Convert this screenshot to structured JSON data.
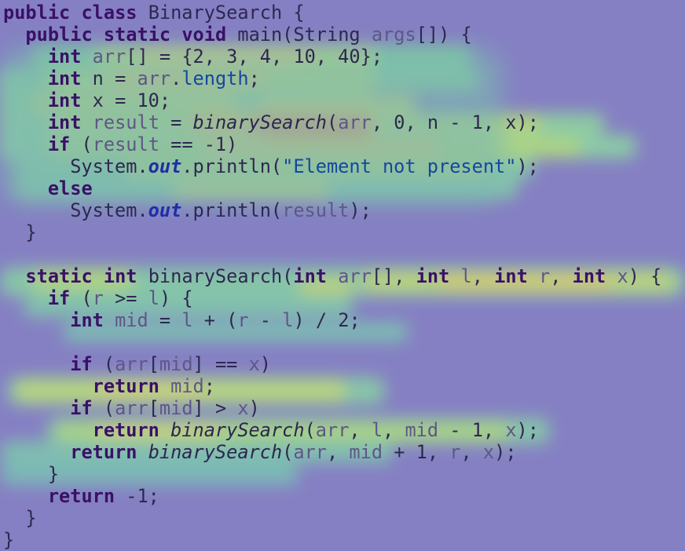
{
  "code": {
    "lines": [
      [
        [
          "kw",
          "public"
        ],
        [
          "id",
          " "
        ],
        [
          "kw",
          "class"
        ],
        [
          "id",
          " BinarySearch {"
        ]
      ],
      [
        [
          "id",
          "  "
        ],
        [
          "kw",
          "public"
        ],
        [
          "id",
          " "
        ],
        [
          "kw",
          "static"
        ],
        [
          "id",
          " "
        ],
        [
          "kw",
          "void"
        ],
        [
          "id",
          " main(String "
        ],
        [
          "var",
          "args"
        ],
        [
          "pun",
          "[]) {"
        ]
      ],
      [
        [
          "id",
          "    "
        ],
        [
          "kw",
          "int"
        ],
        [
          "id",
          " "
        ],
        [
          "var",
          "arr"
        ],
        [
          "pun",
          "[] = {2, 3, 4, 10, 40};"
        ]
      ],
      [
        [
          "id",
          "    "
        ],
        [
          "kw",
          "int"
        ],
        [
          "id",
          " n = "
        ],
        [
          "var",
          "arr"
        ],
        [
          "pun",
          "."
        ],
        [
          "str",
          "length"
        ],
        [
          "pun",
          ";"
        ]
      ],
      [
        [
          "id",
          "    "
        ],
        [
          "kw",
          "int"
        ],
        [
          "id",
          " x = 10;"
        ]
      ],
      [
        [
          "id",
          "    "
        ],
        [
          "kw",
          "int"
        ],
        [
          "id",
          " "
        ],
        [
          "var",
          "result"
        ],
        [
          "id",
          " = "
        ],
        [
          "mth",
          "binarySearch"
        ],
        [
          "pun",
          "("
        ],
        [
          "var",
          "arr"
        ],
        [
          "pun",
          ", 0, n - 1, x);"
        ]
      ],
      [
        [
          "id",
          "    "
        ],
        [
          "kw",
          "if"
        ],
        [
          "id",
          " ("
        ],
        [
          "var",
          "result"
        ],
        [
          "id",
          " == -1)"
        ]
      ],
      [
        [
          "id",
          "      System."
        ],
        [
          "fld",
          "out"
        ],
        [
          "id",
          ".println("
        ],
        [
          "str",
          "\"Element not present\""
        ],
        [
          "id",
          ");"
        ]
      ],
      [
        [
          "id",
          "    "
        ],
        [
          "kw",
          "else"
        ]
      ],
      [
        [
          "id",
          "      System."
        ],
        [
          "fld",
          "out"
        ],
        [
          "id",
          ".println("
        ],
        [
          "var",
          "result"
        ],
        [
          "id",
          ");"
        ]
      ],
      [
        [
          "id",
          "  }"
        ]
      ],
      [
        [
          "id",
          ""
        ]
      ],
      [
        [
          "id",
          "  "
        ],
        [
          "kw",
          "static"
        ],
        [
          "id",
          " "
        ],
        [
          "kw",
          "int"
        ],
        [
          "id",
          " binarySearch("
        ],
        [
          "kw",
          "int"
        ],
        [
          "id",
          " "
        ],
        [
          "var",
          "arr"
        ],
        [
          "pun",
          "[], "
        ],
        [
          "kw",
          "int"
        ],
        [
          "id",
          " "
        ],
        [
          "var",
          "l"
        ],
        [
          "pun",
          ", "
        ],
        [
          "kw",
          "int"
        ],
        [
          "id",
          " "
        ],
        [
          "var",
          "r"
        ],
        [
          "pun",
          ", "
        ],
        [
          "kw",
          "int"
        ],
        [
          "id",
          " "
        ],
        [
          "var",
          "x"
        ],
        [
          "pun",
          ") {"
        ]
      ],
      [
        [
          "id",
          "    "
        ],
        [
          "kw",
          "if"
        ],
        [
          "id",
          " ("
        ],
        [
          "var",
          "r"
        ],
        [
          "id",
          " >= "
        ],
        [
          "var",
          "l"
        ],
        [
          "pun",
          ") {"
        ]
      ],
      [
        [
          "id",
          "      "
        ],
        [
          "kw",
          "int"
        ],
        [
          "id",
          " "
        ],
        [
          "var",
          "mid"
        ],
        [
          "id",
          " = "
        ],
        [
          "var",
          "l"
        ],
        [
          "id",
          " + ("
        ],
        [
          "var",
          "r"
        ],
        [
          "id",
          " - "
        ],
        [
          "var",
          "l"
        ],
        [
          "pun",
          ") / 2;"
        ]
      ],
      [
        [
          "id",
          ""
        ]
      ],
      [
        [
          "id",
          "      "
        ],
        [
          "kw",
          "if"
        ],
        [
          "id",
          " ("
        ],
        [
          "var",
          "arr"
        ],
        [
          "pun",
          "["
        ],
        [
          "var",
          "mid"
        ],
        [
          "pun",
          "] == "
        ],
        [
          "var",
          "x"
        ],
        [
          "pun",
          ")"
        ]
      ],
      [
        [
          "id",
          "        "
        ],
        [
          "kw",
          "return"
        ],
        [
          "id",
          " "
        ],
        [
          "var",
          "mid"
        ],
        [
          "pun",
          ";"
        ]
      ],
      [
        [
          "id",
          "      "
        ],
        [
          "kw",
          "if"
        ],
        [
          "id",
          " ("
        ],
        [
          "var",
          "arr"
        ],
        [
          "pun",
          "["
        ],
        [
          "var",
          "mid"
        ],
        [
          "pun",
          "] > "
        ],
        [
          "var",
          "x"
        ],
        [
          "pun",
          ")"
        ]
      ],
      [
        [
          "id",
          "        "
        ],
        [
          "kw",
          "return"
        ],
        [
          "id",
          " "
        ],
        [
          "mth",
          "binarySearch"
        ],
        [
          "pun",
          "("
        ],
        [
          "var",
          "arr"
        ],
        [
          "pun",
          ", "
        ],
        [
          "var",
          "l"
        ],
        [
          "pun",
          ", "
        ],
        [
          "var",
          "mid"
        ],
        [
          "pun",
          " - 1, "
        ],
        [
          "var",
          "x"
        ],
        [
          "pun",
          ");"
        ]
      ],
      [
        [
          "id",
          "      "
        ],
        [
          "kw",
          "return"
        ],
        [
          "id",
          " "
        ],
        [
          "mth",
          "binarySearch"
        ],
        [
          "pun",
          "("
        ],
        [
          "var",
          "arr"
        ],
        [
          "pun",
          ", "
        ],
        [
          "var",
          "mid"
        ],
        [
          "pun",
          " + 1, "
        ],
        [
          "var",
          "r"
        ],
        [
          "pun",
          ", "
        ],
        [
          "var",
          "x"
        ],
        [
          "pun",
          ");"
        ]
      ],
      [
        [
          "id",
          "    }"
        ]
      ],
      [
        [
          "id",
          "    "
        ],
        [
          "kw",
          "return"
        ],
        [
          "id",
          " -1;"
        ]
      ],
      [
        [
          "id",
          "  }"
        ]
      ],
      [
        [
          "id",
          "}"
        ]
      ]
    ]
  },
  "colors": {
    "background": "#8580c3",
    "keyword": "#3a1068",
    "field": "#1e2ea6",
    "string": "#1447a0",
    "text": "#2e2750"
  }
}
